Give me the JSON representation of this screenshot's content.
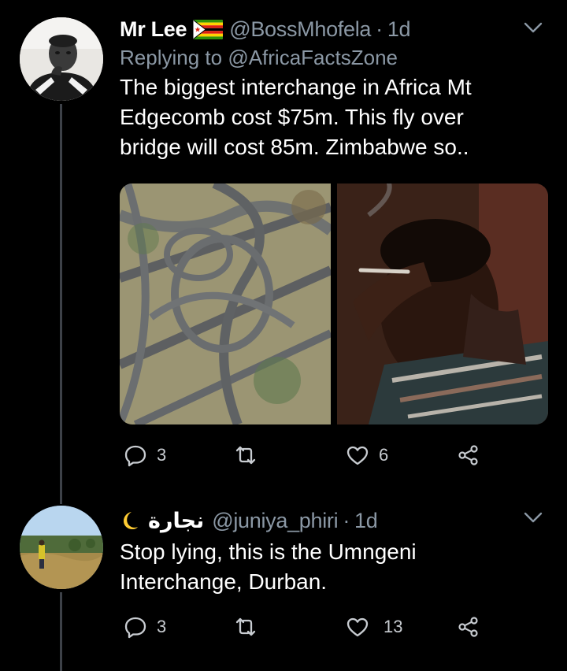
{
  "colors": {
    "background": "#000000",
    "secondary_text": "#8b98a5",
    "thread_line": "#3d4148",
    "icon": "#c8ccd1"
  },
  "tweets": [
    {
      "display_name": "Mr Lee",
      "flag_icon": "zimbabwe-flag-icon",
      "handle": "@BossMhofela",
      "separator": "·",
      "time": "1d",
      "replying_prefix": "Replying to",
      "replying_to": "@AfricaFactsZone",
      "text_lines": [
        "The biggest interchange in Africa Mt",
        "Edgecomb cost $75m. This fly over",
        "bridge will cost 85m. Zimbabwe so.."
      ],
      "media": [
        {
          "alt": "Aerial view of a highway interchange",
          "icon": "interchange-photo"
        },
        {
          "alt": "Man holding a cigarette with hand on forehead",
          "icon": "facepalm-photo"
        }
      ],
      "actions": {
        "reply_count": "3",
        "retweet_count": "",
        "like_count": "6"
      }
    },
    {
      "display_name": "نجارة",
      "name_emoji": "crescent-moon-icon",
      "handle": "@juniya_phiri",
      "separator": "·",
      "time": "1d",
      "text_lines": [
        "Stop lying, this is the Umngeni",
        "Interchange, Durban."
      ],
      "actions": {
        "reply_count": "3",
        "retweet_count": "",
        "like_count": "13"
      }
    }
  ]
}
